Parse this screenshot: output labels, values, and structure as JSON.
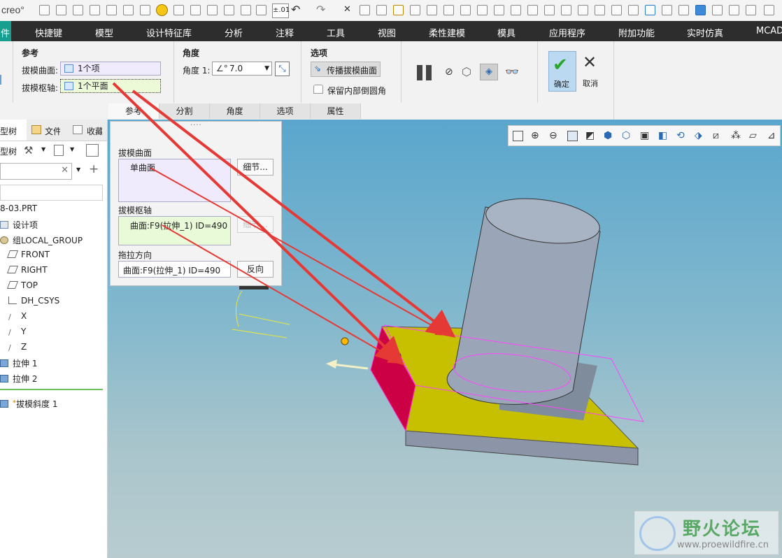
{
  "app": {
    "logo": "creo°"
  },
  "quick_access": {
    "precision_label": "±.01",
    "icons": [
      "new-icon",
      "open-icon",
      "save-icon",
      "smiley-icon",
      "regenerate-icon",
      "measure-icon",
      "undo-icon",
      "redo-icon",
      "close-window-icon"
    ]
  },
  "menubar": {
    "first_tab": "件",
    "items": [
      "快捷键",
      "模型",
      "设计特征库",
      "分析",
      "注释",
      "工具",
      "视图",
      "柔性建模",
      "模具",
      "应用程序",
      "附加功能",
      "实时仿真",
      "MCAD"
    ]
  },
  "dashboard": {
    "ref_group_label": "参考",
    "draft_surface_label": "拔模曲面:",
    "draft_surface_value": "1个项",
    "draft_hinge_label": "拔模枢轴:",
    "draft_hinge_value": "1个平面",
    "angle_group_label": "角度",
    "angle_label": "角度 1:",
    "angle_value": "7.0",
    "options_group_label": "选项",
    "propagate_label": "传播拔模曲面",
    "keep_fillet_label": "保留内部倒圆角",
    "ok_label": "确定",
    "cancel_label": "取消",
    "tabs": [
      "参考",
      "分割",
      "角度",
      "选项",
      "属性"
    ]
  },
  "ref_panel": {
    "surface_section": "拔模曲面",
    "surface_item": "单曲面",
    "details_button": "细节...",
    "hinge_section": "拔模枢轴",
    "hinge_item": "曲面:F9(拉伸_1) ID=490",
    "hinge_details_button": "细节...",
    "pull_section": "拖拉方向",
    "pull_value": "曲面:F9(拉伸_1) ID=490",
    "flip_button": "反向"
  },
  "left_panel": {
    "tabs": [
      "模型树",
      "文件夹",
      "收藏夹"
    ],
    "tree_label": "型树",
    "search_placeholder": "",
    "file_name": "8-03.PRT",
    "items": [
      {
        "label": "设计项",
        "icon": "design-items-icon"
      },
      {
        "label": "组LOCAL_GROUP",
        "icon": "group-icon"
      },
      {
        "label": "FRONT",
        "icon": "datum-plane-icon"
      },
      {
        "label": "RIGHT",
        "icon": "datum-plane-icon"
      },
      {
        "label": "TOP",
        "icon": "datum-plane-icon"
      },
      {
        "label": "DH_CSYS",
        "icon": "csys-icon"
      },
      {
        "label": "X",
        "icon": "axis-icon"
      },
      {
        "label": "Y",
        "icon": "axis-icon"
      },
      {
        "label": "Z",
        "icon": "axis-icon"
      },
      {
        "label": "拉伸 1",
        "icon": "extrude-icon"
      },
      {
        "label": "拉伸 2",
        "icon": "extrude-icon"
      }
    ],
    "insert_item": "拔模斜度 1"
  },
  "watermark": {
    "title": "野火论坛",
    "url": "www.proewildfire.cn"
  },
  "colors": {
    "menubar_bg": "#2d2d2d",
    "menu_accent": "#169e8e",
    "ok_check": "#2aa62a",
    "draft_face": "#cc0044",
    "top_face": "#c6c000",
    "arrow": "#e53935"
  }
}
